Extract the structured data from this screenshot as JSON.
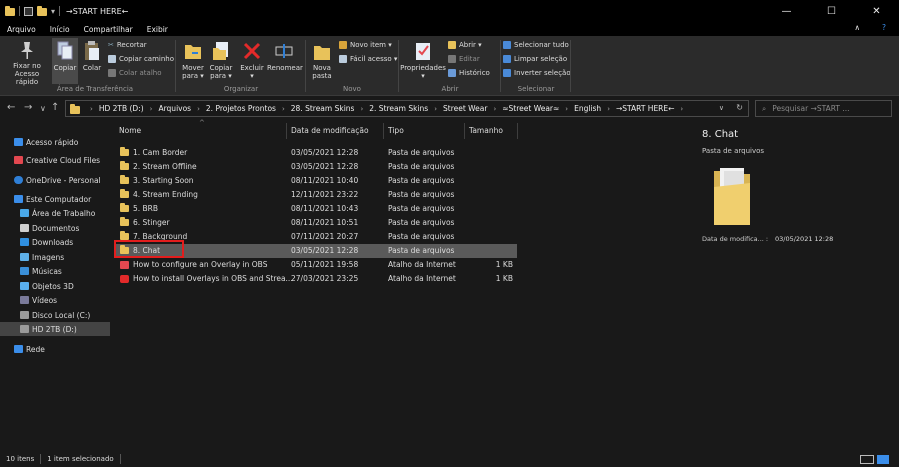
{
  "window": {
    "title": "→START HERE←",
    "minimize": "—",
    "maximize": "☐",
    "close": "✕"
  },
  "menu": {
    "tabs": [
      "Arquivo",
      "Início",
      "Compartilhar",
      "Exibir"
    ]
  },
  "ribbon": {
    "clipboard": {
      "pin": "Fixar no\nAcesso rápido",
      "copy": "Copiar",
      "paste": "Colar",
      "cut": "Recortar",
      "copy_path": "Copiar caminho",
      "paste_shortcut": "Colar atalho",
      "group": "Área de Transferência"
    },
    "organize": {
      "move": "Mover\npara ▾",
      "copy_to": "Copiar\npara ▾",
      "delete": "Excluir\n▾",
      "rename": "Renomear",
      "group": "Organizar"
    },
    "new": {
      "new_folder": "Nova\npasta",
      "new_item": "Novo item ▾",
      "easy_access": "Fácil acesso ▾",
      "group": "Novo"
    },
    "open": {
      "properties": "Propriedades\n▾",
      "open": "Abrir ▾",
      "edit": "Editar",
      "history": "Histórico",
      "group": "Abrir"
    },
    "select": {
      "select_all": "Selecionar tudo",
      "clear": "Limpar seleção",
      "invert": "Inverter seleção",
      "group": "Selecionar"
    }
  },
  "address": {
    "crumbs": [
      "HD 2TB (D:)",
      "Arquivos",
      "2. Projetos Prontos",
      "28. Stream Skins",
      "2. Stream Skins",
      "Street Wear",
      "≈Street Wear≈",
      "English",
      "→START HERE←"
    ],
    "search_placeholder": "Pesquisar →START ..."
  },
  "nav_pane": [
    {
      "label": "Acesso rápido",
      "color": "#3b8eea"
    },
    {
      "label": "Creative Cloud Files",
      "color": "#e34850"
    },
    {
      "label": "OneDrive - Personal",
      "color": "#2f7fd6"
    },
    {
      "label": "Este Computador",
      "color": "#3b8eea"
    },
    {
      "label": "Área de Trabalho",
      "color": "#4aa8e8"
    },
    {
      "label": "Documentos",
      "color": "#cfcfcf"
    },
    {
      "label": "Downloads",
      "color": "#2f8fe0"
    },
    {
      "label": "Imagens",
      "color": "#5fb0e8"
    },
    {
      "label": "Músicas",
      "color": "#3a8fd8"
    },
    {
      "label": "Objetos 3D",
      "color": "#5ab0f0"
    },
    {
      "label": "Vídeos",
      "color": "#7a7a9a"
    },
    {
      "label": "Disco Local (C:)",
      "color": "#9a9a9a"
    },
    {
      "label": "HD 2TB (D:)",
      "color": "#9a9a9a"
    },
    {
      "label": "Rede",
      "color": "#3b8eea"
    }
  ],
  "columns": {
    "name": "Nome",
    "date": "Data de modificação",
    "type": "Tipo",
    "size": "Tamanho"
  },
  "files": [
    {
      "name": "1. Cam Border",
      "date": "03/05/2021 12:28",
      "type": "Pasta de arquivos",
      "size": "",
      "icon": "folder"
    },
    {
      "name": "2. Stream Offline",
      "date": "03/05/2021 12:28",
      "type": "Pasta de arquivos",
      "size": "",
      "icon": "folder"
    },
    {
      "name": "3. Starting Soon",
      "date": "08/11/2021 10:40",
      "type": "Pasta de arquivos",
      "size": "",
      "icon": "folder"
    },
    {
      "name": "4. Stream Ending",
      "date": "12/11/2021 23:22",
      "type": "Pasta de arquivos",
      "size": "",
      "icon": "folder"
    },
    {
      "name": "5. BRB",
      "date": "08/11/2021 10:43",
      "type": "Pasta de arquivos",
      "size": "",
      "icon": "folder"
    },
    {
      "name": "6. Stinger",
      "date": "08/11/2021 10:51",
      "type": "Pasta de arquivos",
      "size": "",
      "icon": "folder"
    },
    {
      "name": "7. Background",
      "date": "07/11/2021 20:27",
      "type": "Pasta de arquivos",
      "size": "",
      "icon": "folder"
    },
    {
      "name": "8. Chat",
      "date": "03/05/2021 12:28",
      "type": "Pasta de arquivos",
      "size": "",
      "icon": "folder",
      "selected": true
    },
    {
      "name": "How to configure an Overlay in OBS",
      "date": "05/11/2021 19:58",
      "type": "Atalho da Internet",
      "size": "1 KB",
      "icon": "shortcut"
    },
    {
      "name": "How to install Overlays in OBS and Strea...",
      "date": "27/03/2021 23:25",
      "type": "Atalho da Internet",
      "size": "1 KB",
      "icon": "shortcut"
    }
  ],
  "preview": {
    "title": "8. Chat",
    "subtitle": "Pasta de arquivos",
    "meta_label": "Data de modifica... :",
    "meta_value": "03/05/2021 12:28"
  },
  "status": {
    "count": "10 itens",
    "selected": "1 item selecionado"
  }
}
